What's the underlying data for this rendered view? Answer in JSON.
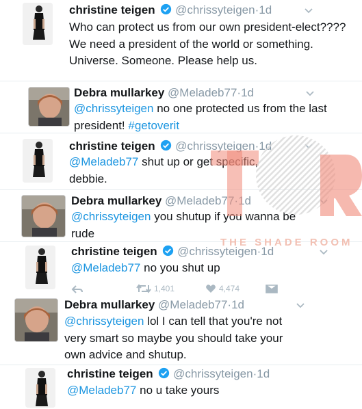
{
  "tweets": [
    {
      "author": "christine teigen",
      "handle": "@chrissyteigen",
      "time": "1d",
      "verified": true,
      "text": "Who can protect us from our own president-elect???? We need a president of the world or something. Universe. Someone. Please help us."
    },
    {
      "author": "Debra mullarkey",
      "handle": "@Meladeb77",
      "time": "1d",
      "verified": false,
      "mention": "@chrissyteigen",
      "text": " no one protected us from the last president! ",
      "hashtag": "#getoverit"
    },
    {
      "author": "christine teigen",
      "handle": "@chrissyteigen",
      "time": "1d",
      "verified": true,
      "mention": "@Meladeb77",
      "text_line1": " shut up or get specific,",
      "text_line2": "debbie."
    },
    {
      "author": "Debra mullarkey",
      "handle": "@Meladeb77",
      "time": "1d",
      "verified": false,
      "mention": "@chrissyteigen",
      "text_line1": " you shutup if you wanna be",
      "text_line2": "rude"
    },
    {
      "author": "christine teigen",
      "handle": "@chrissyteigen",
      "time": "1d",
      "verified": true,
      "mention": "@Meladeb77",
      "text": " no you shut up"
    },
    {
      "author": "Debra mullarkey",
      "handle": "@Meladeb77",
      "time": "1d",
      "verified": false,
      "mention": "@chrissyteigen",
      "text_line1": " lol I can tell that you're not",
      "text_line2": "very smart so maybe you should take your",
      "text_line3": "own advice and shutup."
    },
    {
      "author": "christine teigen",
      "handle": "@chrissyteigen",
      "time": "1d",
      "verified": true,
      "mention": "@Meladeb77",
      "text": " no u take yours"
    }
  ],
  "actions": {
    "retweets": "1,401",
    "likes": "4,474",
    "icons": [
      "reply-icon",
      "retweet-icon",
      "like-icon",
      "message-icon"
    ]
  },
  "watermark": {
    "text": "THE SHADE ROOM",
    "logo": "TSR"
  },
  "colors": {
    "link": "#1b95e0",
    "meta": "#8899a6",
    "verified": "#1da1f2",
    "watermark": "#f08a7a"
  },
  "separator_dot": "·"
}
